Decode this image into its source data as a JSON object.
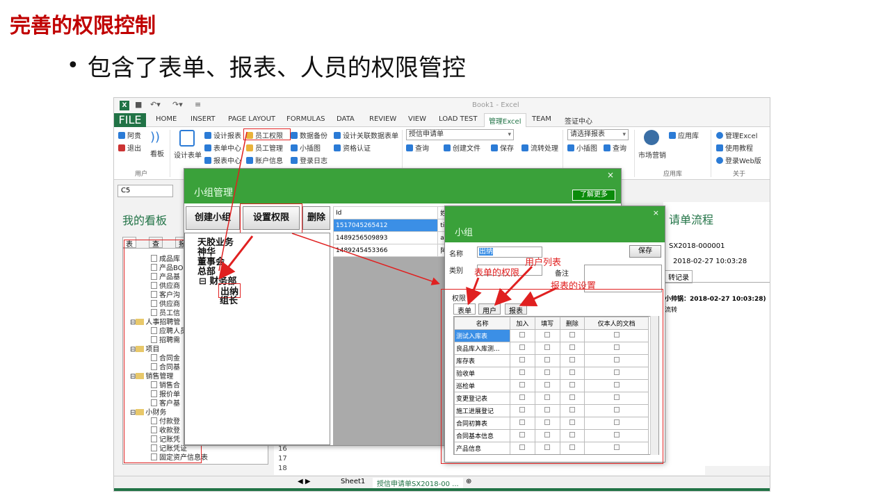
{
  "slide": {
    "title": "完善的权限控制",
    "bullet": "包含了表单、报表、人员的权限管控"
  },
  "excel": {
    "book_title": "Book1 - Excel",
    "tabs": [
      "FILE",
      "HOME",
      "INSERT",
      "PAGE LAYOUT",
      "FORMULAS",
      "DATA",
      "REVIEW",
      "VIEW",
      "LOAD TEST",
      "管理Excel",
      "TEAM",
      "签证中心"
    ],
    "ribbon": {
      "user_group": {
        "a": "阿贵",
        "b": "退出",
        "c": "看板",
        "label": "用户"
      },
      "design_form": "设计表单",
      "items": {
        "design_report": "设计报表",
        "form_center": "表单中心",
        "report_center": "报表中心",
        "staff_perm": "员工权限",
        "staff_mgmt": "员工管理",
        "account_info": "账户信息",
        "data_backup": "数据备份",
        "small_chart": "小插图",
        "login_log": "登录日志",
        "design_relation": "设计关联数据表单",
        "qualification": "资格认证"
      },
      "form_select": "授信申请单",
      "query": "查询",
      "create_file": "创建文件",
      "save": "保存",
      "flow": "流转处理",
      "report_select": "请选择报表",
      "small_chart2": "小插图",
      "query2": "查询",
      "market": "市场营销",
      "app_store": "应用库",
      "app_label": "应用库",
      "mgmt_excel": "管理Excel",
      "tutorial": "使用教程",
      "web_login": "登录Web版",
      "about_label": "关于"
    },
    "namebox": "C5",
    "kanban_title": "我的看板",
    "kanban_tabs": [
      "表单",
      "查询",
      "报"
    ],
    "tree": [
      "成品库",
      "产品BOM",
      "产品基",
      "供应商",
      "客户沟",
      "供应商",
      "员工信",
      "人事招聘管",
      "应聘人员",
      "招聘需",
      "项目",
      "合同金",
      "合同基",
      "销售管理",
      "销售合",
      "报价单",
      "客户基",
      "小财务",
      "付款登",
      "收款登",
      "记账凭",
      "记账凭证",
      "固定资产信息表"
    ],
    "row_numbers": [
      "16",
      "17",
      "18"
    ],
    "sheets": [
      "Sheet1",
      "授信申请单SX2018-00 ..."
    ],
    "right_panel": {
      "title": "请单流程",
      "code": "SX2018-000001",
      "date": "2018-02-27 10:03:28",
      "tab": "转记录",
      "log": "小帅锅：2018-02-27 10:03:28)",
      "log2": "流转"
    }
  },
  "group_dialog": {
    "title": "小组管理",
    "close": "×",
    "learn_more": "了解更多",
    "buttons": {
      "create": "创建小组",
      "set_perm": "设置权限",
      "delete": "删除"
    },
    "tree": [
      "天胶业务",
      "神华",
      "董事会",
      "总部",
      "财务部",
      "出纳",
      "组长"
    ],
    "table_headers": [
      "Id",
      "姓名"
    ],
    "table_rows": [
      [
        "1517045265412",
        "tim"
      ],
      [
        "1489256509893",
        "agui"
      ],
      [
        "1489245453366",
        "阿贵"
      ]
    ]
  },
  "perm_dialog": {
    "title": "小组",
    "close": "×",
    "name_label": "名称",
    "name_value": "出纳",
    "save": "保存",
    "type_label": "类别",
    "note_label": "备注",
    "perm_label": "权限",
    "tabs": [
      "表单",
      "用户",
      "报表"
    ],
    "headers": [
      "名称",
      "加入",
      "填写",
      "删除",
      "仅本人的文档"
    ],
    "rows": [
      "测试入库表",
      "良品库入库测...",
      "库存表",
      "验收单",
      "巡检单",
      "变更登记表",
      "施工进展登记",
      "合同初算表",
      "合同基本信息",
      "产品信息"
    ]
  },
  "annotations": {
    "form_perm": "表单的权限",
    "user_list": "用户列表",
    "report_settings": "报表的设置"
  },
  "colors": {
    "title_red": "#c00000",
    "excel_green": "#217346",
    "dialog_green": "#3aa13a",
    "annotation_red": "#e02020"
  }
}
